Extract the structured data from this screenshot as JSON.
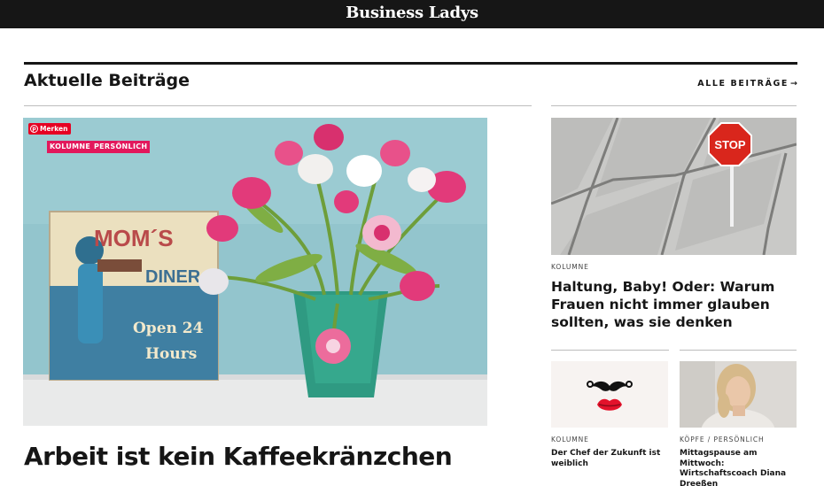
{
  "header": {
    "brand": "Business Ladys"
  },
  "section": {
    "title": "Aktuelle Beiträge",
    "all_link": "ALLE BEITRÄGE",
    "all_link_arrow": "→"
  },
  "featured": {
    "pin_label": "Merken",
    "tags": [
      "KOLUMNE",
      "PERSÖNLICH"
    ],
    "sign_lines": [
      "MOM´S",
      "DINER",
      "Open 24",
      "Hours"
    ],
    "title": "Arbeit ist kein Kaffeekränzchen"
  },
  "side_article": {
    "category": "KOLUMNE",
    "sign_text": "STOP",
    "title": "Haltung, Baby! Oder: Warum Frauen nicht immer glauben sollten, was sie denken"
  },
  "small_articles": [
    {
      "category": "KOLUMNE",
      "title": "Der Chef der Zukunft ist weiblich"
    },
    {
      "category": "KÖPFE  /  PERSÖNLICH",
      "title": "Mittagspause am Mittwoch: Wirtschaftscoach Diana Dreeßen"
    }
  ],
  "colors": {
    "topbar": "#161616",
    "tag": "#e2185c",
    "pin": "#e60023",
    "text": "#161616"
  }
}
